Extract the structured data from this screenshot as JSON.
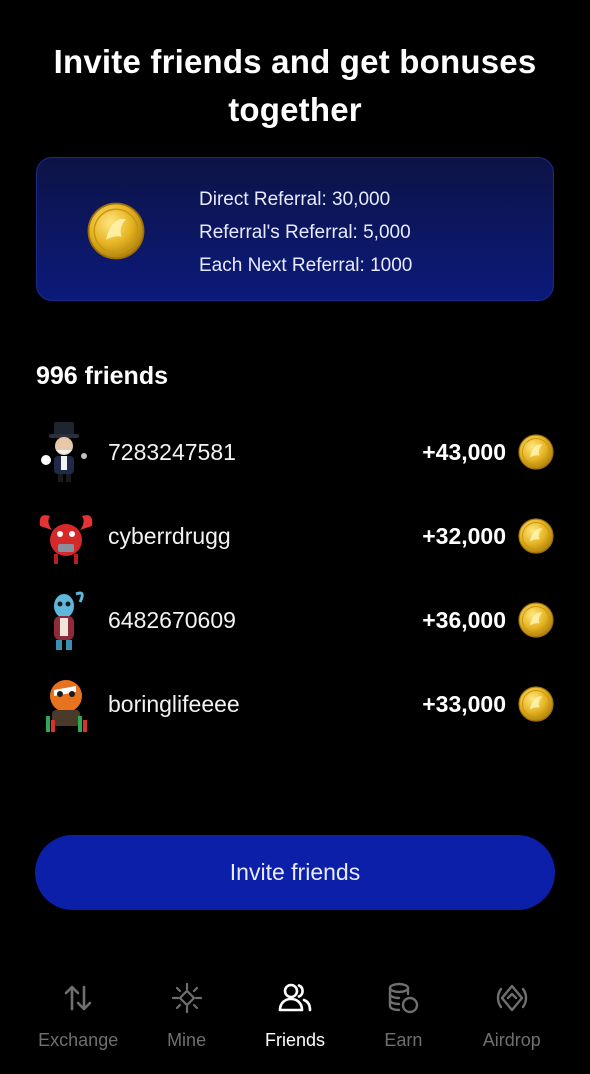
{
  "header": {
    "title": "Invite friends and get bonuses together"
  },
  "bonus": {
    "lines": [
      "Direct Referral: 30,000",
      "Referral's Referral: 5,000",
      "Each Next Referral: 1000"
    ],
    "icon": "gold-coin-icon"
  },
  "friends": {
    "count_label": "996 friends",
    "items": [
      {
        "name": "7283247581",
        "reward": "+43,000",
        "avatar": "monopoly-man-avatar"
      },
      {
        "name": "cyberrdrugg",
        "reward": "+32,000",
        "avatar": "red-crab-avatar"
      },
      {
        "name": "6482670609",
        "reward": "+36,000",
        "avatar": "blue-creature-avatar"
      },
      {
        "name": "boringlifeeee",
        "reward": "+33,000",
        "avatar": "orange-fish-avatar"
      }
    ]
  },
  "invite_button": {
    "label": "Invite friends"
  },
  "tabbar": {
    "tabs": [
      {
        "label": "Exchange",
        "icon": "arrows-up-down-icon",
        "active": false
      },
      {
        "label": "Mine",
        "icon": "mine-pickaxe-icon",
        "active": false
      },
      {
        "label": "Friends",
        "icon": "users-icon",
        "active": true
      },
      {
        "label": "Earn",
        "icon": "coins-stack-icon",
        "active": false
      },
      {
        "label": "Airdrop",
        "icon": "airdrop-icon",
        "active": false
      }
    ]
  },
  "colors": {
    "background": "#000000",
    "accent_blue": "#0b1fa8",
    "card_gradient_top": "#0d1346",
    "card_gradient_bottom": "#0b1a7a",
    "coin_gold": "#e8b923",
    "tab_inactive": "#6f6f6f"
  }
}
